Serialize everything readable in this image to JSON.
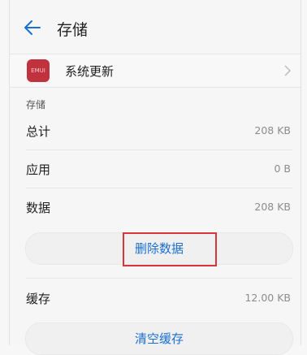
{
  "header": {
    "title": "存储"
  },
  "app": {
    "icon_text": "EMUI",
    "name": "系统更新"
  },
  "section": {
    "label": "存储"
  },
  "rows": [
    {
      "label": "总计",
      "value": "208 KB"
    },
    {
      "label": "应用",
      "value": "0 B"
    },
    {
      "label": "数据",
      "value": "208 KB"
    }
  ],
  "actions": {
    "delete_data": "删除数据",
    "clear_cache": "清空缓存"
  },
  "cache": {
    "label": "缓存",
    "value": "12.00 KB"
  },
  "colors": {
    "accent": "#1a6fd1",
    "highlight": "#d9343a",
    "app_icon": "#c0323d"
  }
}
